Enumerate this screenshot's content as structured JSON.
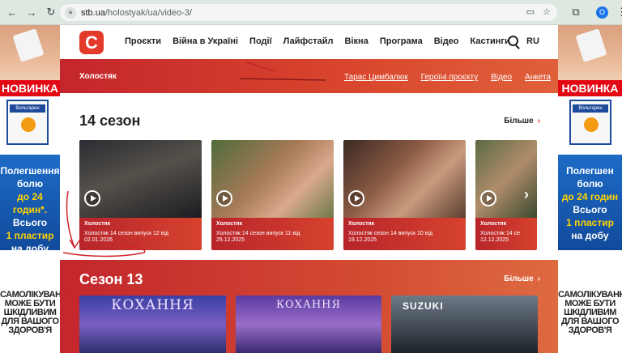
{
  "browser": {
    "url_host": "stb.ua",
    "url_path": "/holostyak/ua/video-3/",
    "profile_initial": "O"
  },
  "ads": {
    "badge": "НОВИНКА",
    "product": "Вольтарен",
    "left_lines": [
      "Полегшення",
      "болю",
      "до 24 годин*.",
      "Всього",
      "1 пластир",
      "на добу"
    ],
    "right_lines": [
      "Полегшен",
      "болю",
      "до 24 годин",
      "Всього",
      "1 пластир",
      "на добу"
    ],
    "bottom_text": "САМОЛІКУВАННЯ МОЖЕ БУТИ ШКІДЛИВИМ ДЛЯ ВАШОГО ЗДОРОВ'Я"
  },
  "site": {
    "logo": "С",
    "nav": [
      "Проєкти",
      "Війна в Україні",
      "Події",
      "Лайфстайл",
      "Вікна",
      "Програма",
      "Відео",
      "Кастинги"
    ],
    "lang": "RU",
    "show_title": "Холостяк",
    "show_links": [
      "Тарас Цимбалюк",
      "Героїні проєкту",
      "Відео",
      "Анкета"
    ],
    "season14": {
      "title": "14 сезон",
      "more": "Більше",
      "cards": [
        {
          "show": "Холостяк",
          "episode": "Холостяк 14 сезон випуск 12 від",
          "date": "02.01.2026"
        },
        {
          "show": "Холостяк",
          "episode": "Холостяк 14 сезон випуск 11 від",
          "date": "26.12.2025"
        },
        {
          "show": "Холостяк",
          "episode": "Холостяк сезон 14 випуск 10 від",
          "date": "19.12.2025"
        },
        {
          "show": "Холостяк",
          "episode": "Холостяк 14 се",
          "date": "12.12.2025"
        }
      ]
    },
    "season13": {
      "title": "Сезон 13",
      "more": "Більше",
      "cards": [
        {
          "overlay": "КОХАННЯ"
        },
        {
          "overlay": "КОХАННЯ"
        },
        {
          "overlay": "SUZUKI"
        }
      ]
    }
  },
  "colors": {
    "brand_red": "#e33a2a",
    "bar_red": "#c3262c",
    "ad_blue": "#1e6cc7"
  }
}
